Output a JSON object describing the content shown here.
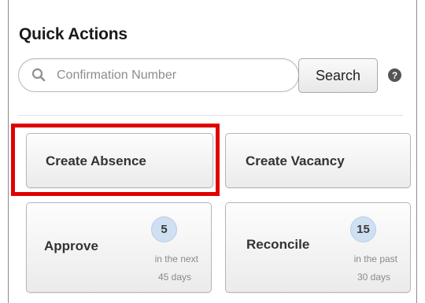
{
  "panel": {
    "title": "Quick Actions"
  },
  "search": {
    "placeholder": "Confirmation Number",
    "value": "",
    "button_label": "Search"
  },
  "icons": {
    "search": "magnifier-icon",
    "help": "question-circle-icon"
  },
  "actions": {
    "create_absence": {
      "label": "Create Absence",
      "highlighted": true,
      "highlight_color": "#e10000"
    },
    "create_vacancy": {
      "label": "Create Vacancy"
    },
    "approve": {
      "label": "Approve",
      "count": "5",
      "line1": "in the next",
      "line2": "45 days"
    },
    "reconcile": {
      "label": "Reconcile",
      "count": "15",
      "line1": "in the past",
      "line2": "30 days"
    }
  },
  "colors": {
    "badge": "#cfe0f3",
    "highlight": "#e10000"
  }
}
